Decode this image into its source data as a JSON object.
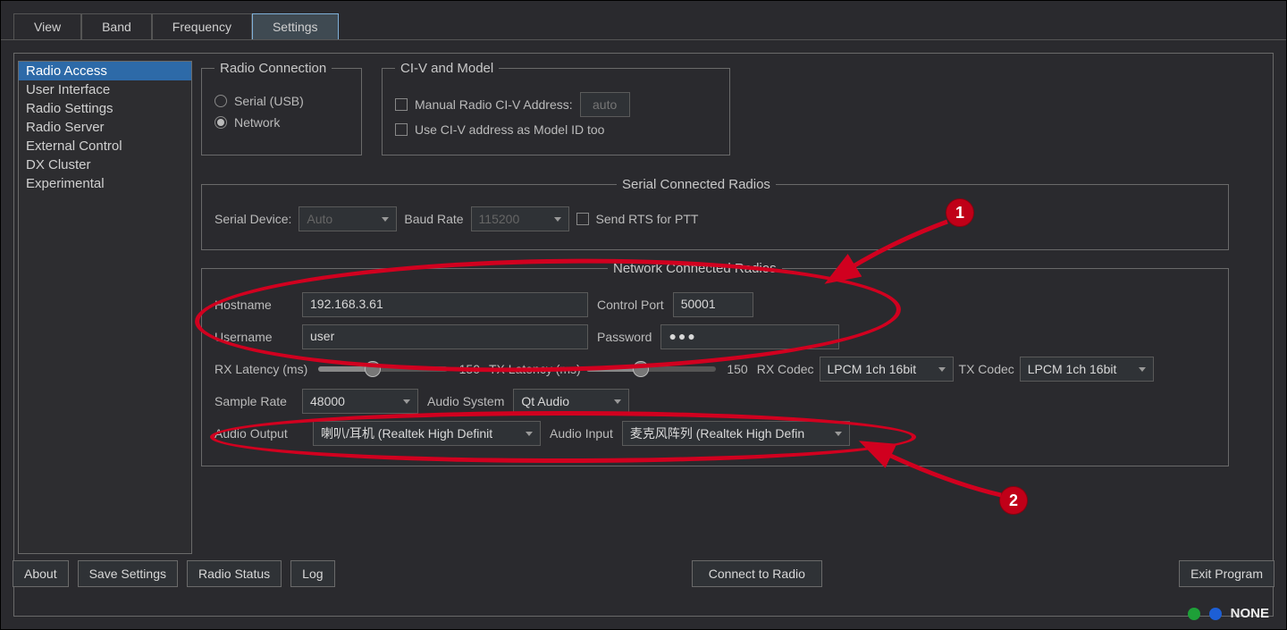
{
  "tabs": [
    "View",
    "Band",
    "Frequency",
    "Settings"
  ],
  "active_tab": "Settings",
  "sidebar": {
    "items": [
      "Radio Access",
      "User Interface",
      "Radio Settings",
      "Radio Server",
      "External Control",
      "DX Cluster",
      "Experimental"
    ],
    "selected": "Radio Access"
  },
  "radio_connection": {
    "legend": "Radio Connection",
    "serial_label": "Serial (USB)",
    "network_label": "Network",
    "selected": "Network"
  },
  "civ": {
    "legend": "CI-V and Model",
    "manual_label": "Manual Radio CI-V Address:",
    "auto_placeholder": "auto",
    "useasmodel_label": "Use CI-V address as Model ID too"
  },
  "serial_group": {
    "legend": "Serial Connected Radios",
    "serial_device_label": "Serial Device:",
    "serial_device_value": "Auto",
    "baud_label": "Baud Rate",
    "baud_value": "115200",
    "rts_label": "Send RTS for PTT"
  },
  "network_group": {
    "legend": "Network Connected Radios",
    "hostname_label": "Hostname",
    "hostname_value": "192.168.3.61",
    "control_port_label": "Control Port",
    "control_port_value": "50001",
    "username_label": "Username",
    "username_value": "user",
    "password_label": "Password",
    "password_value": "●●●",
    "rx_latency_label": "RX Latency (ms)",
    "rx_latency_value": "150",
    "tx_latency_label": "TX Latency (ms)",
    "tx_latency_value": "150",
    "rx_codec_label": "RX Codec",
    "rx_codec_value": "LPCM 1ch 16bit",
    "tx_codec_label": "TX Codec",
    "tx_codec_value": "LPCM 1ch 16bit",
    "sample_rate_label": "Sample Rate",
    "sample_rate_value": "48000",
    "audio_system_label": "Audio System",
    "audio_system_value": "Qt Audio",
    "audio_output_label": "Audio Output",
    "audio_output_value": "喇叭/耳机 (Realtek High Definit",
    "audio_input_label": "Audio Input",
    "audio_input_value": "麦克风阵列 (Realtek High Defin"
  },
  "buttons": {
    "about": "About",
    "save": "Save Settings",
    "radio_status": "Radio Status",
    "log": "Log",
    "connect": "Connect to Radio",
    "exit": "Exit Program"
  },
  "status": {
    "text": "NONE"
  },
  "annotations": {
    "b1": "1",
    "b2": "2"
  }
}
